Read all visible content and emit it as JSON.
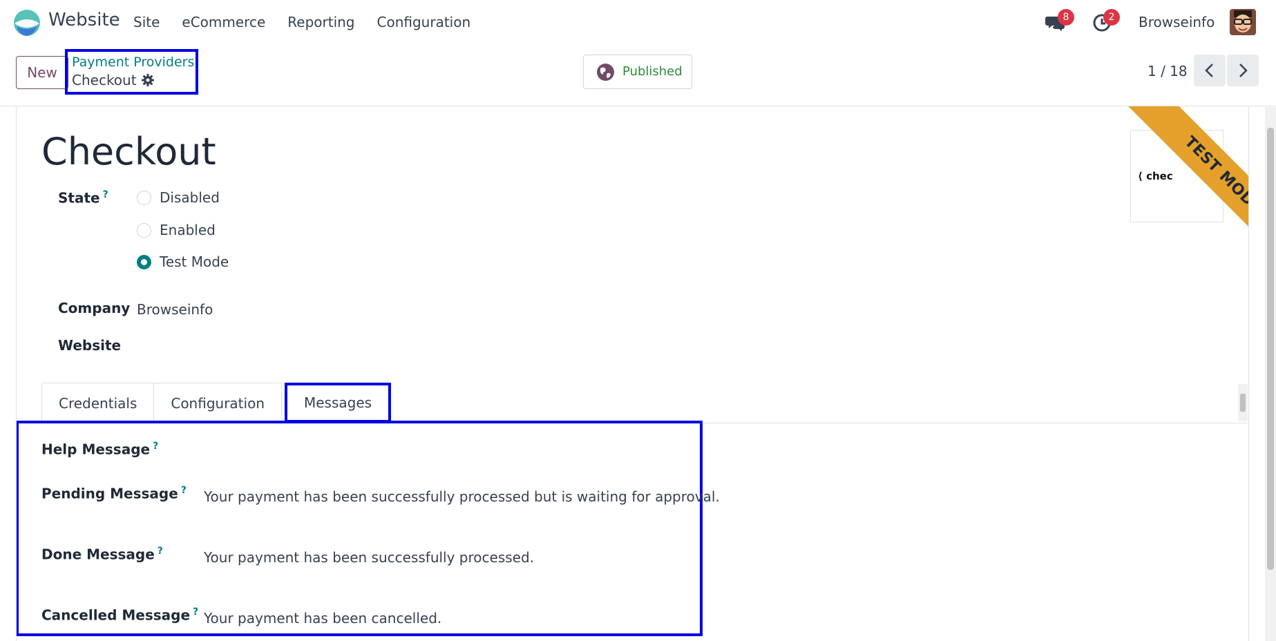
{
  "navbar": {
    "app_name": "Website",
    "menu": [
      "Site",
      "eCommerce",
      "Reporting",
      "Configuration"
    ],
    "messages_count": "8",
    "activities_count": "2",
    "user_name": "Browseinfo"
  },
  "control_panel": {
    "new_label": "New",
    "breadcrumb_parent": "Payment Providers",
    "breadcrumb_current": "Checkout",
    "published_label": "Published",
    "pager": "1 / 18"
  },
  "form": {
    "title": "Checkout",
    "state_label": "State",
    "state_options": [
      "Disabled",
      "Enabled",
      "Test Mode"
    ],
    "state_selected": "Test Mode",
    "company_label": "Company",
    "company_value": "Browseinfo",
    "website_label": "Website",
    "ribbon": "TEST MODE",
    "image_text": "chec"
  },
  "tabs": [
    "Credentials",
    "Configuration",
    "Messages"
  ],
  "active_tab": "Messages",
  "messages": {
    "help_label": "Help Message",
    "pending_label": "Pending Message",
    "pending_value": "Your payment has been successfully processed but is waiting for approval.",
    "done_label": "Done Message",
    "done_value": "Your payment has been successfully processed.",
    "cancelled_label": "Cancelled Message",
    "cancelled_value": "Your payment has been cancelled."
  },
  "colors": {
    "primary": "#714b67",
    "link": "#017e84",
    "highlight": "#0000e6",
    "ribbon": "#e4a02a",
    "badge": "#dc3545",
    "published": "#2e8b3a"
  }
}
